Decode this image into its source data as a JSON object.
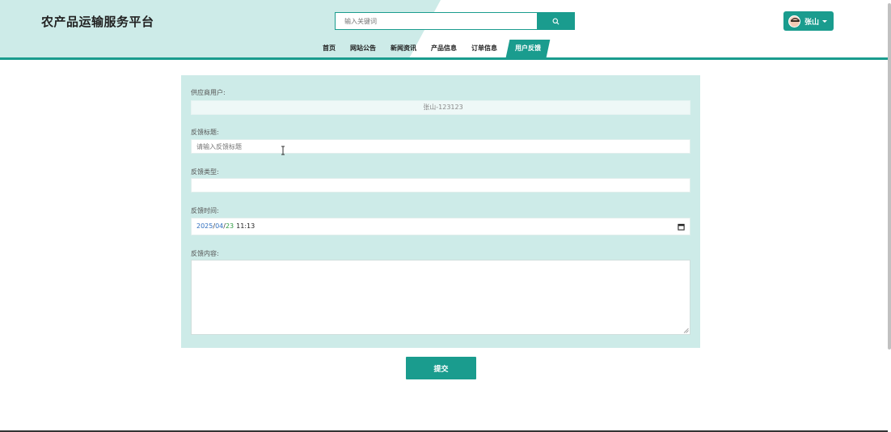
{
  "header": {
    "site_title": "农产品运输服务平台",
    "search_placeholder": "输入关键词",
    "user_name": "张山"
  },
  "nav": {
    "items": [
      {
        "label": "首页"
      },
      {
        "label": "网站公告"
      },
      {
        "label": "新闻资讯"
      },
      {
        "label": "产品信息"
      },
      {
        "label": "订单信息"
      },
      {
        "label": "用户反馈"
      }
    ],
    "active_index": 5
  },
  "form": {
    "supplier_label": "供应商用户:",
    "supplier_value": "张山-123123",
    "title_label": "反馈标题:",
    "title_placeholder": "请输入反馈标题",
    "type_label": "反馈类型:",
    "type_value": "",
    "time_label": "反馈时间:",
    "time_year": "2025",
    "time_sep": "/",
    "time_month": "04",
    "time_day": "23",
    "time_clock": "11:13",
    "content_label": "反馈内容:",
    "submit_label": "提交"
  },
  "colors": {
    "accent": "#1a9c8e",
    "panel": "#cdebe8",
    "header_tint": "#cdebe8"
  },
  "icons": {
    "search": "search-icon",
    "calendar": "calendar-icon",
    "avatar": "avatar-icon",
    "caret": "chevron-down-icon",
    "cursor": "text-cursor-icon"
  }
}
